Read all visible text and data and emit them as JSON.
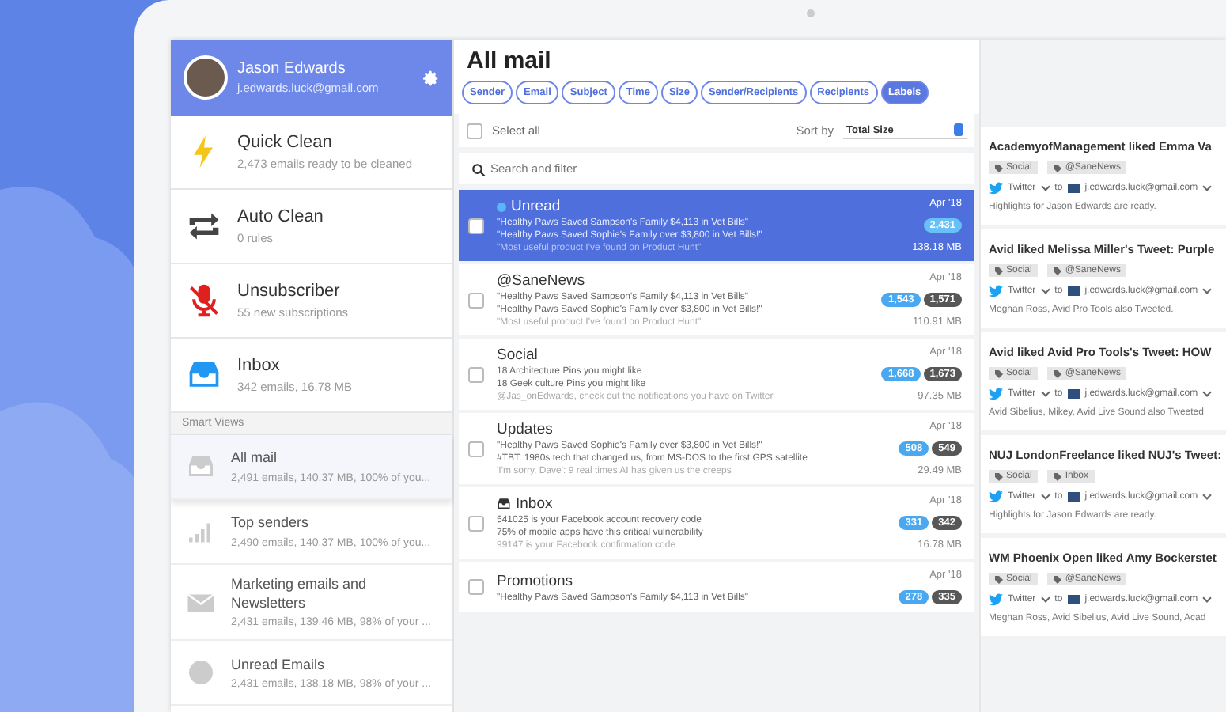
{
  "sidebar": {
    "user": {
      "name": "Jason Edwards",
      "email": "j.edwards.luck@gmail.com"
    },
    "tools": [
      {
        "title": "Quick Clean",
        "subtitle": "2,473 emails ready to be cleaned"
      },
      {
        "title": "Auto Clean",
        "subtitle": "0 rules"
      },
      {
        "title": "Unsubscriber",
        "subtitle": "55 new subscriptions"
      },
      {
        "title": "Inbox",
        "subtitle": "342 emails, 16.78 MB"
      }
    ],
    "section_label": "Smart Views",
    "views": [
      {
        "title": "All mail",
        "subtitle": "2,491 emails, 140.37 MB, 100% of you...",
        "selected": true
      },
      {
        "title": "Top senders",
        "subtitle": "2,490 emails, 140.37 MB, 100% of you...",
        "selected": false
      },
      {
        "title": "Marketing emails and Newsletters",
        "subtitle": "2,431 emails, 139.46 MB, 98% of your ...",
        "selected": false
      },
      {
        "title": "Unread Emails",
        "subtitle": "2,431 emails, 138.18 MB, 98% of your ...",
        "selected": false
      }
    ]
  },
  "main": {
    "title": "All mail",
    "tabs": [
      {
        "label": "Sender",
        "selected": false
      },
      {
        "label": "Email",
        "selected": false
      },
      {
        "label": "Subject",
        "selected": false
      },
      {
        "label": "Time",
        "selected": false
      },
      {
        "label": "Size",
        "selected": false
      },
      {
        "label": "Sender/Recipients",
        "selected": false
      },
      {
        "label": "Recipients",
        "selected": false
      },
      {
        "label": "Labels",
        "selected": true
      }
    ],
    "select_all": {
      "label": "Select all",
      "checked": false
    },
    "sort": {
      "label": "Sort by",
      "value": "Total Size"
    },
    "search": {
      "placeholder": "Search and filter"
    },
    "groups": [
      {
        "kind": "unread",
        "title": "Unread",
        "selected": true,
        "date": "Apr '18",
        "size": "138.18 MB",
        "lines": [
          "\"Healthy Paws Saved Sampson's Family $4,113 in Vet Bills\"",
          "\"Healthy Paws Saved Sophie's Family over $3,800 in Vet Bills!\"",
          "\"Most useful product I've found on Product Hunt\""
        ],
        "badges": [
          {
            "kind": "unread",
            "text": "2,431"
          }
        ]
      },
      {
        "kind": "plain",
        "title": "@SaneNews",
        "selected": false,
        "date": "Apr '18",
        "size": "110.91 MB",
        "lines": [
          "\"Healthy Paws Saved Sampson's Family $4,113 in Vet Bills\"",
          "\"Healthy Paws Saved Sophie's Family over $3,800 in Vet Bills!\"",
          "\"Most useful product I've found on Product Hunt\""
        ],
        "badges": [
          {
            "kind": "unread",
            "text": "1,543"
          },
          {
            "kind": "total",
            "text": "1,571"
          }
        ]
      },
      {
        "kind": "plain",
        "title": "Social",
        "selected": false,
        "date": "Apr '18",
        "size": "97.35 MB",
        "lines": [
          "18 Architecture Pins you might like",
          "18 Geek culture Pins you might like",
          "@Jas_onEdwards, check out the notifications you have on Twitter"
        ],
        "badges": [
          {
            "kind": "unread",
            "text": "1,668"
          },
          {
            "kind": "total",
            "text": "1,673"
          }
        ]
      },
      {
        "kind": "plain",
        "title": "Updates",
        "selected": false,
        "date": "Apr '18",
        "size": "29.49 MB",
        "lines": [
          "\"Healthy Paws Saved Sophie's Family over $3,800 in Vet Bills!\"",
          "#TBT: 1980s tech that changed us, from MS-DOS to the first GPS satellite",
          "'I'm sorry, Dave': 9 real times AI has given us the creeps"
        ],
        "badges": [
          {
            "kind": "unread",
            "text": "508"
          },
          {
            "kind": "total",
            "text": "549"
          }
        ]
      },
      {
        "kind": "inbox",
        "title": "Inbox",
        "selected": false,
        "date": "Apr '18",
        "size": "16.78 MB",
        "lines": [
          "541025 is your Facebook account recovery code",
          "75% of mobile apps have this critical vulnerability",
          "99147 is your Facebook confirmation code"
        ],
        "badges": [
          {
            "kind": "unread",
            "text": "331"
          },
          {
            "kind": "total",
            "text": "342"
          }
        ]
      },
      {
        "kind": "plain",
        "title": "Promotions",
        "selected": false,
        "date": "Apr '18",
        "lines": [
          "\"Healthy Paws Saved Sampson's Family $4,113 in Vet Bills\""
        ],
        "badges": [
          {
            "kind": "unread",
            "text": "278"
          },
          {
            "kind": "total",
            "text": "335"
          }
        ]
      }
    ]
  },
  "details": {
    "cards": [
      {
        "title": "AcademyofManagement liked Emma Va",
        "tags": [
          "Social",
          "@SaneNews"
        ],
        "source": "Twitter",
        "to": "to",
        "recipient": "j.edwards.luck@gmail.com",
        "text": "Highlights for Jason Edwards are ready."
      },
      {
        "title": "Avid liked Melissa Miller's Tweet: Purple",
        "tags": [
          "Social",
          "@SaneNews"
        ],
        "source": "Twitter",
        "to": "to",
        "recipient": "j.edwards.luck@gmail.com",
        "text": "Meghan Ross, Avid Pro Tools also Tweeted."
      },
      {
        "title": "Avid liked Avid Pro Tools's Tweet: HOW",
        "tags": [
          "Social",
          "@SaneNews"
        ],
        "source": "Twitter",
        "to": "to",
        "recipient": "j.edwards.luck@gmail.com",
        "text": "Avid Sibelius, Mikey, Avid Live Sound also Tweeted"
      },
      {
        "title": "NUJ LondonFreelance liked NUJ's Tweet:",
        "tags": [
          "Social",
          "Inbox"
        ],
        "source": "Twitter",
        "to": "to",
        "recipient": "j.edwards.luck@gmail.com",
        "text": "Highlights for Jason Edwards are ready."
      },
      {
        "title": "WM Phoenix Open liked Amy Bockerstet",
        "tags": [
          "Social",
          "@SaneNews"
        ],
        "source": "Twitter",
        "to": "to",
        "recipient": "j.edwards.luck@gmail.com",
        "text": "Meghan Ross, Avid Sibelius, Avid Live Sound, Acad"
      }
    ]
  }
}
